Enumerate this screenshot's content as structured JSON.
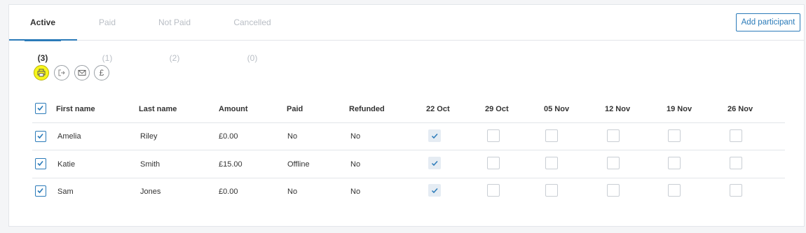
{
  "tabs": [
    {
      "label": "Active (3)",
      "active": true
    },
    {
      "label": "Paid (1)",
      "active": false
    },
    {
      "label": "Not Paid (2)",
      "active": false
    },
    {
      "label": "Cancelled (0)",
      "active": false
    }
  ],
  "add_button_label": "Add participant",
  "action_icons": [
    {
      "icon": "print-icon",
      "highlighted": true
    },
    {
      "icon": "export-icon",
      "highlighted": false
    },
    {
      "icon": "email-icon",
      "highlighted": false
    },
    {
      "icon": "pound-icon",
      "highlighted": false,
      "glyph": "£"
    }
  ],
  "table": {
    "headers": [
      "First name",
      "Last name",
      "Amount",
      "Paid",
      "Refunded",
      "22 Oct",
      "29 Oct",
      "05 Nov",
      "12 Nov",
      "19 Nov",
      "26 Nov"
    ],
    "select_all_checked": true,
    "rows": [
      {
        "selected": true,
        "first": "Amelia",
        "last": "Riley",
        "amount": "£0.00",
        "paid": "No",
        "refunded": "No",
        "attendance": [
          true,
          false,
          false,
          false,
          false,
          false
        ]
      },
      {
        "selected": true,
        "first": "Katie",
        "last": "Smith",
        "amount": "£15.00",
        "paid": "Offline",
        "refunded": "No",
        "attendance": [
          true,
          false,
          false,
          false,
          false,
          false
        ]
      },
      {
        "selected": true,
        "first": "Sam",
        "last": "Jones",
        "amount": "£0.00",
        "paid": "No",
        "refunded": "No",
        "attendance": [
          true,
          false,
          false,
          false,
          false,
          false
        ]
      }
    ]
  },
  "colors": {
    "accent": "#2b7bb9",
    "highlight": "#f7f61c",
    "muted_tab": "#b9bec5"
  }
}
